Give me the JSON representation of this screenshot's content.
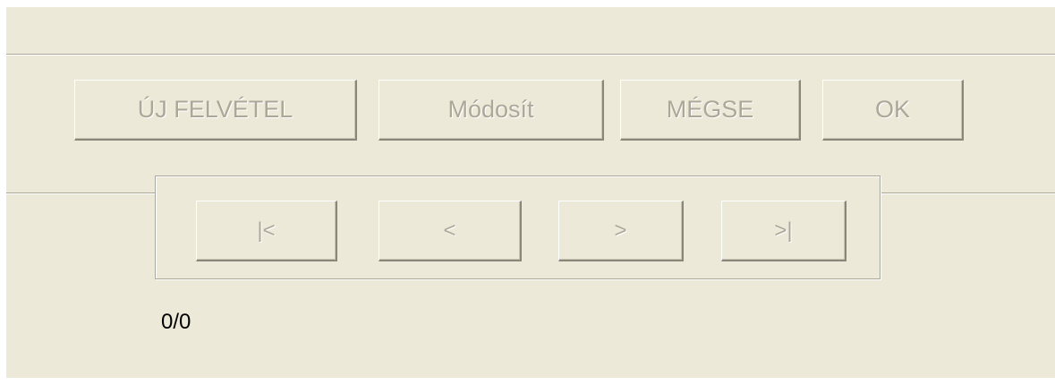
{
  "toolbar": {
    "new_label": "ÚJ FELVÉTEL",
    "modify_label": "Módosít",
    "cancel_label": "MÉGSE",
    "ok_label": "OK"
  },
  "navigation": {
    "first_label": "|<",
    "prev_label": "<",
    "next_label": ">",
    "last_label": ">|"
  },
  "record_counter": "0/0",
  "colors": {
    "window_background": "#ece9d8",
    "disabled_text": "#aca899",
    "counter_text": "#000000"
  }
}
